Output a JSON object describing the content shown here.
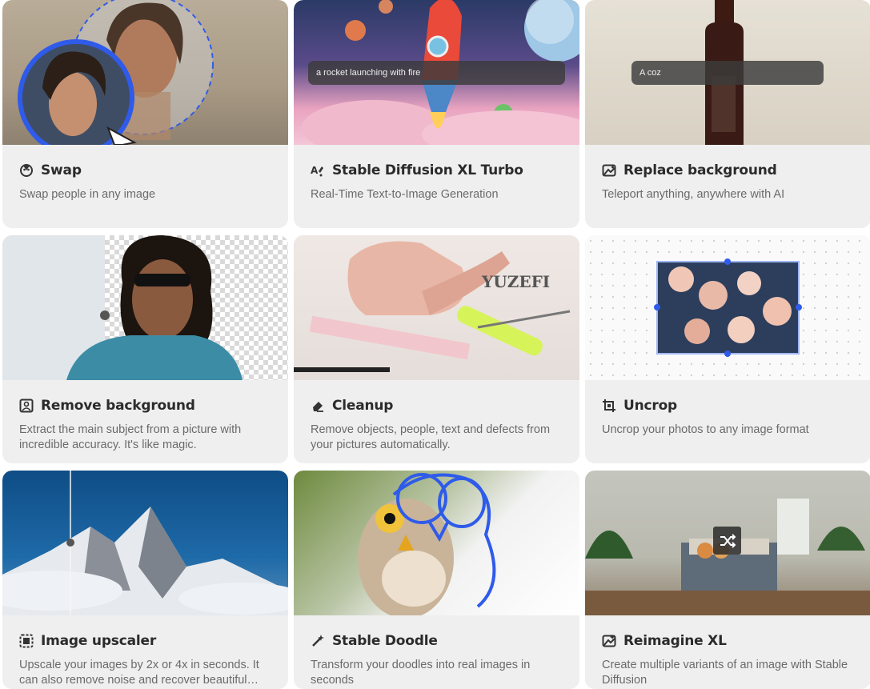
{
  "cards": [
    {
      "title": "Swap",
      "desc": "Swap people in any image",
      "icon": "face-swap-icon"
    },
    {
      "title": "Stable Diffusion XL Turbo",
      "desc": "Real-Time Text-to-Image Generation",
      "icon": "text-to-image-icon",
      "prompt": "a rocket launching with fire"
    },
    {
      "title": "Replace background",
      "desc": "Teleport anything, anywhere with AI",
      "icon": "replace-background-icon",
      "prompt": "A coz"
    },
    {
      "title": "Remove background",
      "desc": "Extract the main subject from a picture with incredible accuracy. It's like magic.",
      "icon": "remove-background-icon"
    },
    {
      "title": "Cleanup",
      "desc": "Remove objects, people, text and defects from your pictures automatically.",
      "icon": "eraser-icon"
    },
    {
      "title": "Uncrop",
      "desc": "Uncrop your photos to any image format",
      "icon": "uncrop-icon"
    },
    {
      "title": "Image upscaler",
      "desc": "Upscale your images by 2x or 4x in seconds. It can also remove noise and recover beautiful…",
      "icon": "upscale-icon"
    },
    {
      "title": "Stable Doodle",
      "desc": "Transform your doodles into real images in seconds",
      "icon": "magic-wand-icon"
    },
    {
      "title": "Reimagine XL",
      "desc": "Create multiple variants of an image with Stable Diffusion",
      "icon": "reimagine-icon"
    }
  ],
  "colors": {
    "accent": "#2f5bea",
    "card_bg": "#efefef",
    "title": "#2b2b2b",
    "desc": "#6a6a6a"
  }
}
